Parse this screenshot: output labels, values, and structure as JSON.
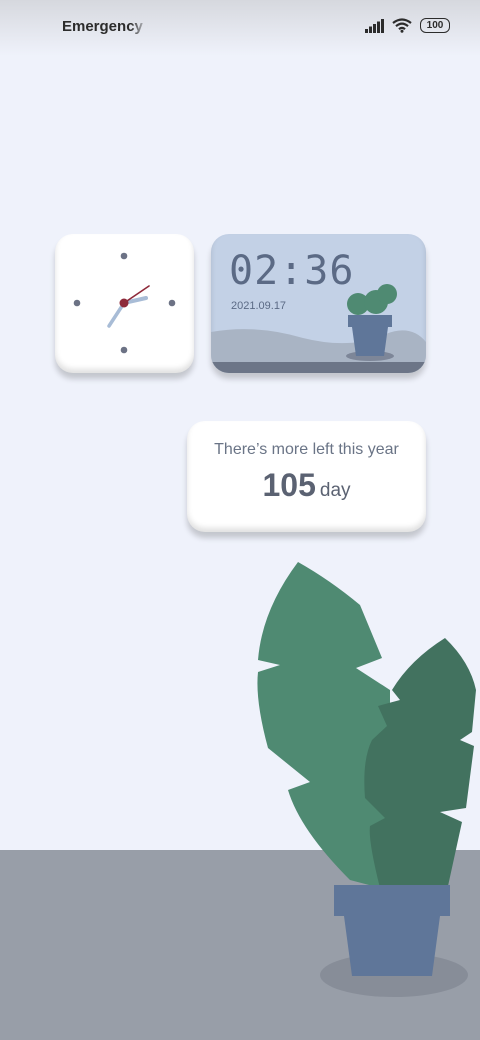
{
  "status_bar": {
    "carrier": "Emergency calls only",
    "battery": "100",
    "icons": [
      "signal-icon",
      "wifi-icon",
      "battery-icon"
    ]
  },
  "clock_widget": {
    "type": "analog-clock",
    "time": "02:36",
    "colors": {
      "face": "#ffffff",
      "hands": "#a8bcd6",
      "second_hand": "#8e2a3a",
      "dots": "#6c7285"
    }
  },
  "digital_widget": {
    "time": "02:36",
    "date": "2021.09.17",
    "colors": {
      "background": "#c3d1e6",
      "text": "#5b6a85",
      "pot": "#5f7699",
      "cactus": "#4f8a72"
    }
  },
  "year_widget": {
    "caption": "There’s more left this year",
    "days_left": "105",
    "unit": "day"
  },
  "wallpaper": {
    "colors": {
      "sky": "#eff2fb",
      "floor": "#989ea8",
      "leaf_light": "#4f8a72",
      "leaf_dark": "#42725f",
      "pot": "#5f7699"
    }
  }
}
